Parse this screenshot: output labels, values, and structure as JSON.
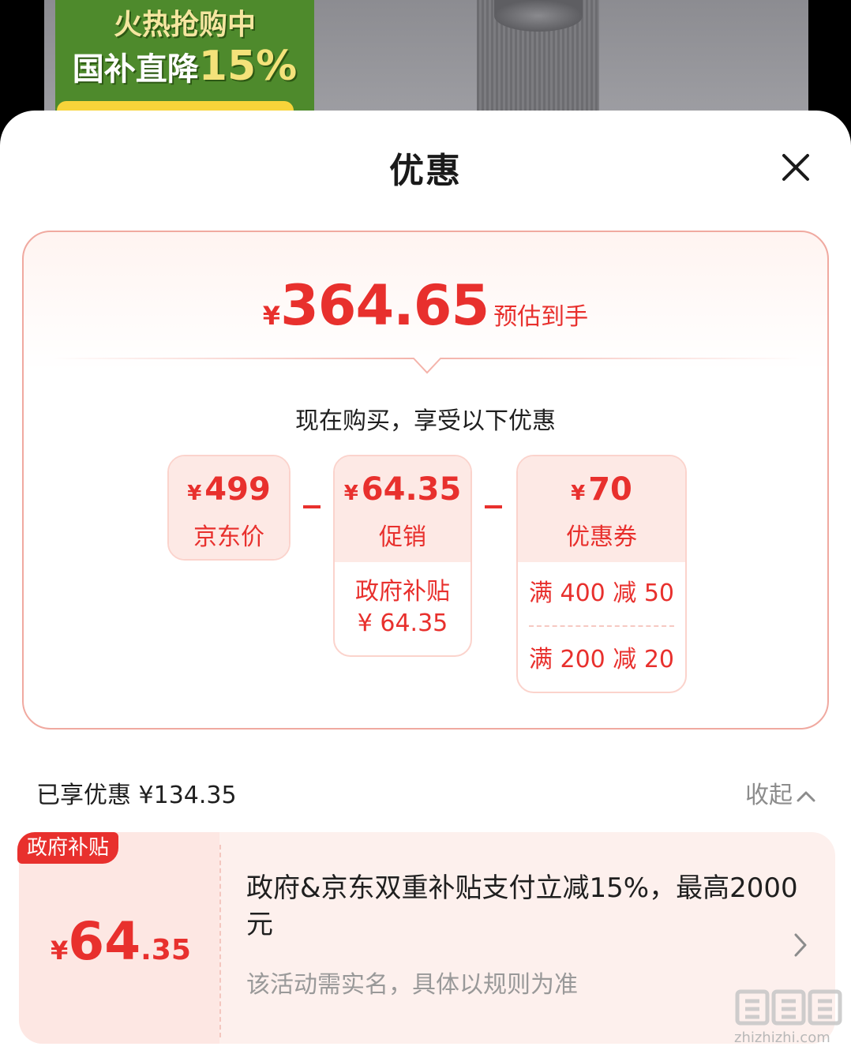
{
  "banner": {
    "promo_line1": "火热抢购中",
    "promo_line2": "国补直降",
    "promo_pct": "15%"
  },
  "sheet": {
    "title": "优惠",
    "close_icon": "close-icon"
  },
  "estimate": {
    "currency": "¥",
    "amount": "364.65",
    "label": "预估到手"
  },
  "breakdown": {
    "subtitle": "现在购买，享受以下优惠",
    "items": [
      {
        "currency": "¥",
        "amount": "499",
        "label": "京东价"
      },
      {
        "currency": "¥",
        "amount": "64.35",
        "label": "促销",
        "details": [
          "政府补贴",
          "¥ 64.35"
        ]
      },
      {
        "currency": "¥",
        "amount": "70",
        "label": "优惠券",
        "details": [
          "满 400 减 50",
          "满 200 减 20"
        ]
      }
    ]
  },
  "saved": {
    "label": "已享优惠 ¥134.35",
    "collapse_label": "收起"
  },
  "subsidy_card": {
    "badge": "政府补贴",
    "currency": "¥",
    "amount_int": "64",
    "amount_dec": ".35",
    "description": "政府&京东双重补贴支付立减15%，最高2000元",
    "note": "该活动需实名，具体以规则为准"
  },
  "watermark": {
    "text": "zhizhizhi.com"
  },
  "colors": {
    "accent": "#e8302d",
    "card_border": "#f0a9a0",
    "tile_bg": "#fde9e5"
  }
}
